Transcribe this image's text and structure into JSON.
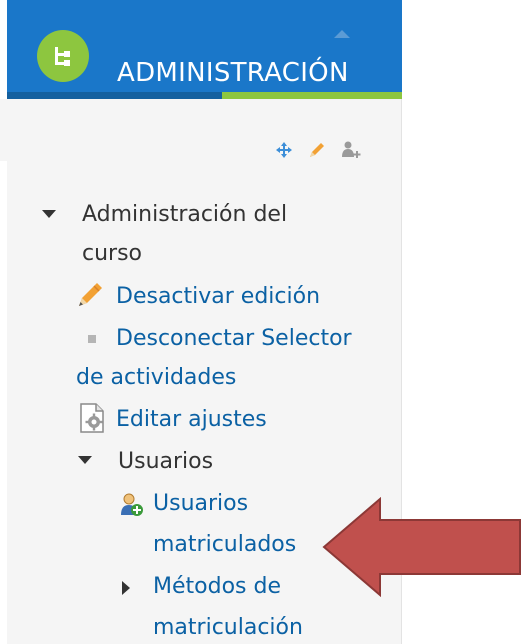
{
  "block": {
    "title": "ADMINISTRACIÓN",
    "icons": [
      "dock-tree-icon",
      "collapse-icon",
      "move-icon",
      "edit-icon",
      "assign-roles-icon"
    ]
  },
  "tree": {
    "course_admin": "Administración del curso",
    "course_admin_line1": "Administración del",
    "course_admin_line2": "curso",
    "turn_editing_off": "Desactivar edición",
    "activity_chooser_line1": "Desconectar Selector",
    "activity_chooser_line2": "de actividades",
    "edit_settings": "Editar ajustes",
    "users": "Usuarios",
    "enrolled_users_line1": "Usuarios",
    "enrolled_users_line2": "matriculados",
    "enrolment_methods_line1": "Métodos de",
    "enrolment_methods_line2": "matriculación"
  },
  "colors": {
    "header": "#1a77c9",
    "accent_green": "#8dc63f",
    "link": "#0b61a4",
    "callout_arrow": "#c0504d"
  }
}
